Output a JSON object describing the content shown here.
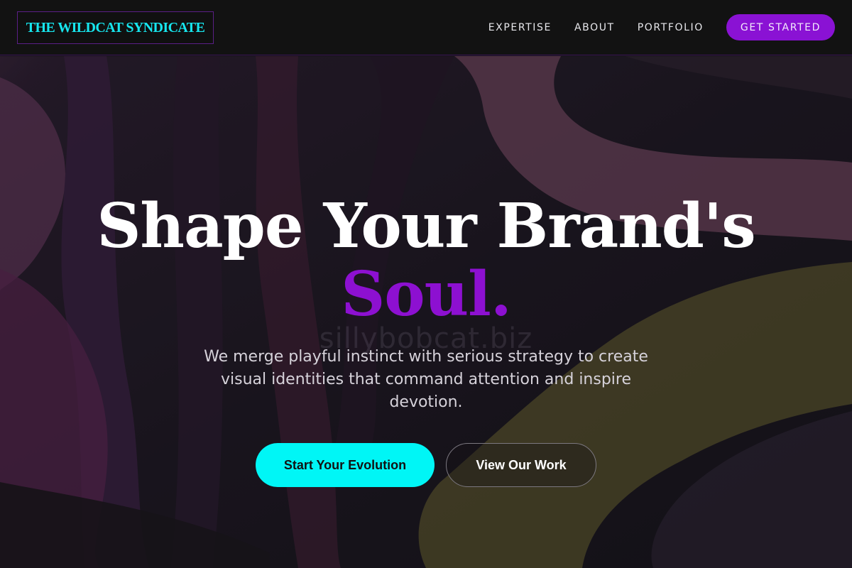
{
  "nav": {
    "logo": "THE WILDCAT SYNDICATE",
    "links": [
      "EXPERTISE",
      "ABOUT",
      "PORTFOLIO"
    ],
    "cta": "GET STARTED"
  },
  "hero": {
    "headline_line1": "Shape Your Brand's",
    "headline_line2": "Soul.",
    "watermark": "sillybobcat.biz",
    "subtext": "We merge playful instinct with serious strategy to create visual identities that command attention and inspire devotion.",
    "primary_button": "Start Your Evolution",
    "secondary_button": "View Our Work"
  },
  "colors": {
    "accent_purple": "#8a12d4",
    "accent_cyan": "#00f6f6",
    "background": "#141216"
  }
}
